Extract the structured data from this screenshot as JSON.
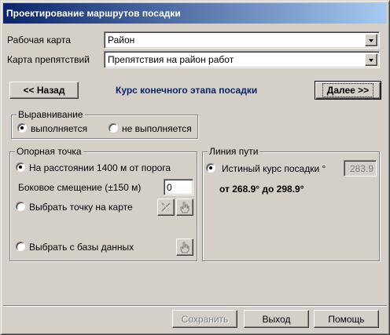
{
  "window": {
    "title": "Проектирование маршрутов посадки"
  },
  "fields": {
    "work_map": {
      "label": "Рабочая карта",
      "value": "Район"
    },
    "obstacle_map": {
      "label": "Карта препятствий",
      "value": "Препятствия на район работ"
    }
  },
  "nav": {
    "back_label": "<< Назад",
    "heading": "Курс конечного этапа посадки",
    "next_label": "Далее >>"
  },
  "alignment": {
    "legend": "Выравнивание",
    "opt_on": "выполняется",
    "opt_off": "не выполняется",
    "selected": "on"
  },
  "ref_point": {
    "legend": "Опорная точка",
    "opt_distance": "На расстоянии 1400 м от порога",
    "lateral_label": "Боковое смещение (±150 м)",
    "lateral_value": "0",
    "opt_map": "Выбрать точку на карте",
    "opt_db": "Выбрать с базы данных",
    "selected": "distance"
  },
  "path_line": {
    "legend": "Линия пути",
    "course_label": "Истиный курс посадки °",
    "course_value": "283.9",
    "range_text": "от 268.9° до 298.9°"
  },
  "footer": {
    "save_label": "Сохранить",
    "exit_label": "Выход",
    "help_label": "Помощь"
  }
}
